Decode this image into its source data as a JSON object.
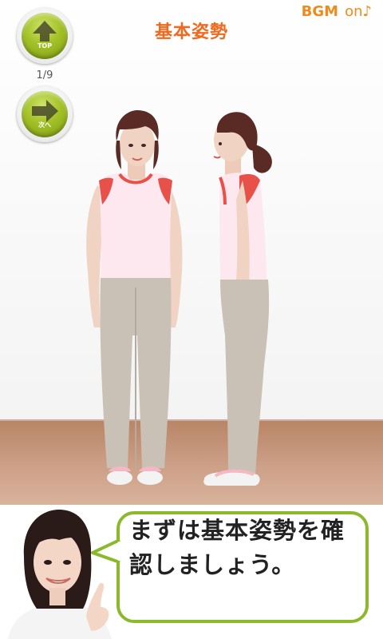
{
  "header": {
    "title": "基本姿勢",
    "bgm_label": "BGM",
    "bgm_state": "on♪"
  },
  "nav": {
    "top_button_label": "TOP",
    "next_button_label": "次へ",
    "page_indicator": "1/9"
  },
  "dialog": {
    "message": "まずは基本姿勢を確認しましょう。"
  },
  "colors": {
    "accent_orange": "#ef6a1f",
    "button_green": "#9cbb22",
    "bubble_border": "#8cb82b",
    "floor": "#c79478"
  },
  "icons": {
    "top": "up-arrow-icon",
    "next": "right-arrow-icon"
  }
}
